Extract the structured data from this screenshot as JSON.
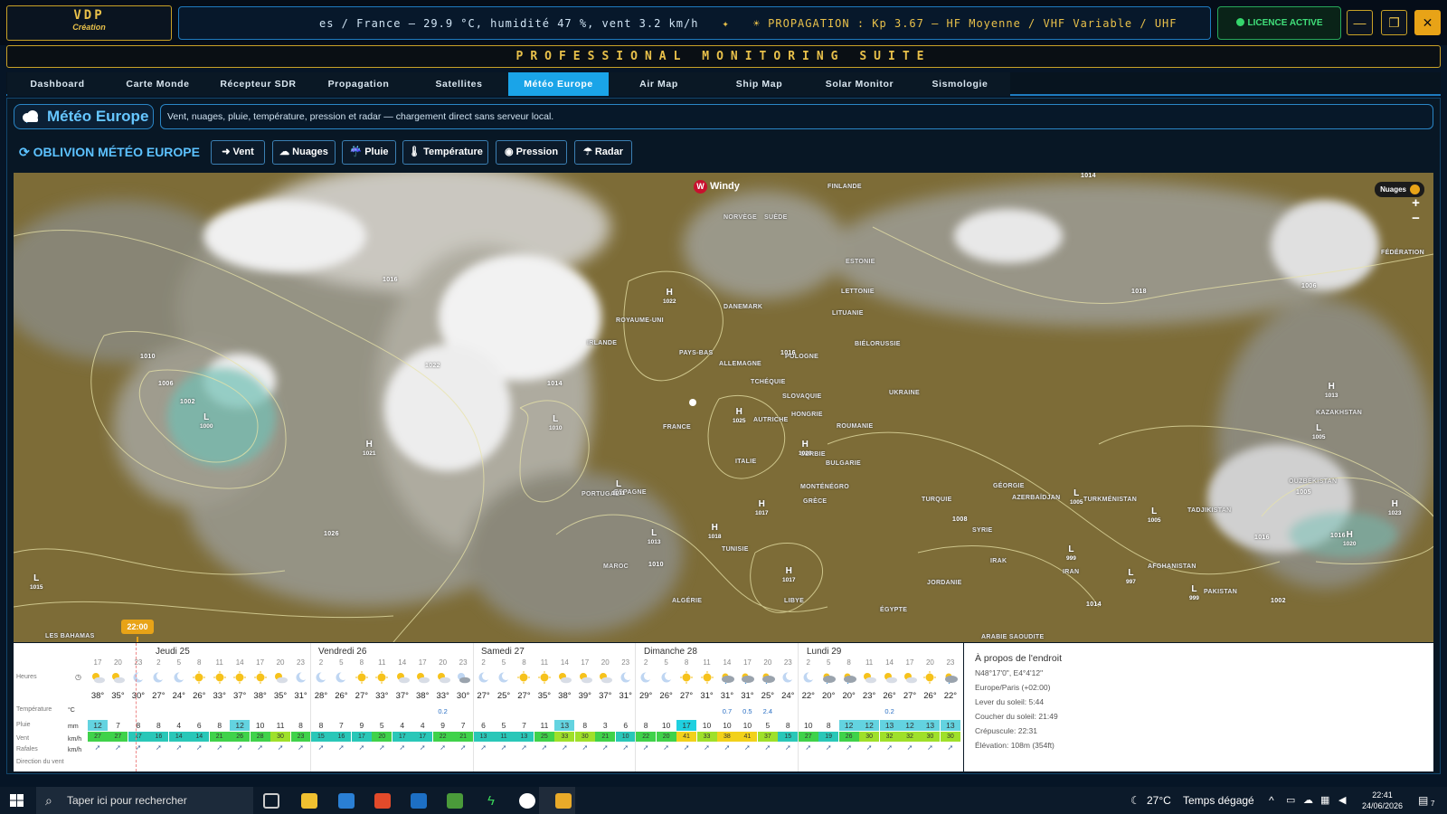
{
  "app": {
    "logo_title": "VDP",
    "logo_subtitle": "Création",
    "ticker": "es / France — 29.9 °C, humidité 47 %, vent 3.2 km/h",
    "ticker_sep": "✦",
    "propagation": "☀ PROPAGATION : Kp 3.67 — HF Moyenne / VHF Variable / UHF",
    "license": "LICENCE ACTIVE",
    "suite_title": "PROFESSIONAL MONITORING SUITE",
    "win_minimize": "—",
    "win_restore": "❐",
    "win_close": "✕"
  },
  "tabs": [
    {
      "label": "Dashboard"
    },
    {
      "label": "Carte Monde"
    },
    {
      "label": "Récepteur SDR"
    },
    {
      "label": "Propagation"
    },
    {
      "label": "Satellites"
    },
    {
      "label": "Météo Europe",
      "active": true
    },
    {
      "label": "Air Map"
    },
    {
      "label": "Ship Map"
    },
    {
      "label": "Solar Monitor"
    },
    {
      "label": "Sismologie"
    }
  ],
  "page": {
    "title": "Météo Europe",
    "description": "Vent, nuages, pluie, température, pression et radar — chargement direct sans serveur local.",
    "section_title": "OBLIVION MÉTÉO EUROPE",
    "layers": [
      {
        "label": "➜ Vent"
      },
      {
        "label": "☁ Nuages"
      },
      {
        "label": "☔ Pluie"
      },
      {
        "label": "🌡 Température"
      },
      {
        "label": "◉ Pression"
      },
      {
        "label": "☂ Radar"
      }
    ]
  },
  "map": {
    "brand": "Windy",
    "layer_badge": "Nuages",
    "zoom_in": "+",
    "zoom_out": "−",
    "labels": [
      "FINLANDE",
      "NORVÈGE",
      "SUÈDE",
      "ESTONIE",
      "LETTONIE",
      "LITUANIE",
      "BIÉLORUSSIE",
      "DANEMARK",
      "ROYAUME-UNI",
      "IRLANDE",
      "PAYS-BAS",
      "ALLEMAGNE",
      "POLOGNE",
      "TCHÉQUIE",
      "SLOVAQUIE",
      "HONGRIE",
      "ROUMANIE",
      "UKRAINE",
      "FRANCE",
      "ITALIE",
      "SERBIE",
      "BULGARIE",
      "GRÈCE",
      "TURQUIE",
      "ESPAGNE",
      "PORTUGAL",
      "MAROC",
      "ALGÉRIE",
      "TUNISIE",
      "LIBYE",
      "ÉGYPTE",
      "IRAK",
      "IRAN",
      "JORDANIE",
      "SYRIE",
      "KAZAKHSTAN",
      "OUZBÉKISTAN",
      "TURKMÉNISTAN",
      "AZERBAÏDJAN",
      "AFGHANISTAN",
      "PAKISTAN",
      "TADJIKISTAN",
      "FÉDÉRATION",
      "ARABIE SAOUDITE",
      "LES BAHAMAS",
      "GÉORGIE",
      "AUTRICHE",
      "MONTÉNÉGRO"
    ],
    "pressure_centers": [
      {
        "type": "H",
        "value": "1022"
      },
      {
        "type": "H",
        "value": "1025"
      },
      {
        "type": "H",
        "value": "1020"
      },
      {
        "type": "H",
        "value": "1017"
      },
      {
        "type": "H",
        "value": "1018"
      },
      {
        "type": "H",
        "value": "1017"
      },
      {
        "type": "L",
        "value": "1010"
      },
      {
        "type": "L",
        "value": "1011"
      },
      {
        "type": "L",
        "value": "1013"
      },
      {
        "type": "L",
        "value": "1000"
      },
      {
        "type": "H",
        "value": "1021"
      },
      {
        "type": "H",
        "value": "1013"
      },
      {
        "type": "L",
        "value": "1005"
      },
      {
        "type": "L",
        "value": "1005"
      },
      {
        "type": "L",
        "value": "1005"
      },
      {
        "type": "L",
        "value": "999"
      },
      {
        "type": "L",
        "value": "997"
      },
      {
        "type": "L",
        "value": "999"
      },
      {
        "type": "H",
        "value": "1023"
      },
      {
        "type": "H",
        "value": "1020"
      },
      {
        "type": "L",
        "value": "1015"
      }
    ],
    "isobar_labels": [
      "1010",
      "1016",
      "1022",
      "1014",
      "1016",
      "1006",
      "1002",
      "1026",
      "1018",
      "1016",
      "1014",
      "1010",
      "1008",
      "1006",
      "1002",
      "1016",
      "1014",
      "1005"
    ],
    "time_marker": "22:00"
  },
  "forecast": {
    "days": [
      "Jeudi 25",
      "Vendredi 26",
      "Samedi 27",
      "Dimanche 28",
      "Lundi 29"
    ],
    "row_labels": {
      "hours": "Heures",
      "temp": "Température",
      "rain": "Pluie",
      "wind": "Vent",
      "gusts": "Rafales",
      "dir": "Direction du vent"
    },
    "units": {
      "temp": "°C",
      "rain": "mm",
      "wind": "km/h",
      "gusts": "km/h"
    },
    "hours": [
      "17",
      "20",
      "23",
      "2",
      "5",
      "8",
      "11",
      "14",
      "17",
      "20",
      "23",
      "2",
      "5",
      "8",
      "11",
      "14",
      "17",
      "20",
      "23",
      "2",
      "5",
      "8",
      "11",
      "14",
      "17",
      "20",
      "23",
      "2",
      "5",
      "8",
      "11",
      "14",
      "17",
      "20",
      "23",
      "2",
      "5",
      "8",
      "11",
      "14",
      "17",
      "20",
      "23"
    ],
    "icons": [
      "sunc",
      "sunc",
      "moon",
      "moon",
      "moon",
      "sun",
      "sun",
      "sun",
      "sun",
      "sunc",
      "moon",
      "moon",
      "moon",
      "sun",
      "sun",
      "sunc",
      "sunc",
      "sunc",
      "cloudm",
      "moon",
      "moon",
      "sun",
      "sun",
      "sunc",
      "sunc",
      "sunc",
      "moon",
      "moon",
      "moon",
      "sun",
      "sun",
      "cloud",
      "cloud",
      "cloud",
      "moon",
      "moon",
      "cloud",
      "cloud",
      "sunc",
      "sunc",
      "sunc",
      "sun",
      "cloud"
    ],
    "temps": [
      "38°",
      "35°",
      "30°",
      "27°",
      "24°",
      "26°",
      "33°",
      "37°",
      "38°",
      "35°",
      "31°",
      "28°",
      "26°",
      "27°",
      "33°",
      "37°",
      "38°",
      "33°",
      "30°",
      "27°",
      "25°",
      "27°",
      "35°",
      "38°",
      "39°",
      "37°",
      "31°",
      "29°",
      "26°",
      "27°",
      "31°",
      "31°",
      "31°",
      "25°",
      "24°",
      "22°",
      "20°",
      "20°",
      "23°",
      "26°",
      "27°",
      "26°",
      "22°"
    ],
    "rain": [
      "",
      "",
      "",
      "",
      "",
      "",
      "",
      "",
      "",
      "",
      "",
      "",
      "",
      "",
      "",
      "",
      "",
      "0.2",
      "",
      "",
      "",
      "",
      "",
      "",
      "",
      "",
      "",
      "",
      "",
      "",
      "",
      "0.7",
      "0.5",
      "2.4",
      "",
      "",
      "",
      "",
      "",
      "0.2",
      "",
      "",
      ""
    ],
    "wind": [
      "12",
      "7",
      "8",
      "8",
      "4",
      "6",
      "8",
      "12",
      "10",
      "11",
      "8",
      "8",
      "7",
      "9",
      "5",
      "4",
      "4",
      "9",
      "7",
      "6",
      "5",
      "7",
      "11",
      "13",
      "8",
      "3",
      "6",
      "8",
      "10",
      "17",
      "10",
      "10",
      "10",
      "5",
      "8",
      "10",
      "8",
      "12",
      "12",
      "13",
      "12",
      "13",
      "13"
    ],
    "gusts": [
      "27",
      "27",
      "17",
      "16",
      "14",
      "14",
      "21",
      "26",
      "28",
      "30",
      "23",
      "15",
      "16",
      "17",
      "20",
      "17",
      "17",
      "22",
      "21",
      "13",
      "11",
      "13",
      "25",
      "33",
      "30",
      "21",
      "10",
      "22",
      "20",
      "41",
      "33",
      "38",
      "41",
      "37",
      "15",
      "27",
      "19",
      "26",
      "30",
      "32",
      "32",
      "30",
      "30"
    ]
  },
  "about": {
    "title": "À propos de l'endroit",
    "coords": "N48°17'0\", E4°4'12\"",
    "timezone": "Europe/Paris (+02:00)",
    "sunrise": "Lever du soleil: 5:44",
    "sunset": "Coucher du soleil: 21:49",
    "dusk": "Crépuscule: 22:31",
    "elevation": "Élévation: 108m (354ft)"
  },
  "taskbar": {
    "search_placeholder": "Taper ici pour rechercher",
    "weather_temp": "27°C",
    "weather_text": "Temps dégagé",
    "time": "22:41",
    "date": "24/06/2026",
    "notif_count": "7"
  },
  "colors": {
    "gold": "#e8c04a",
    "accent": "#1aa4e8",
    "license": "#35d66c"
  }
}
